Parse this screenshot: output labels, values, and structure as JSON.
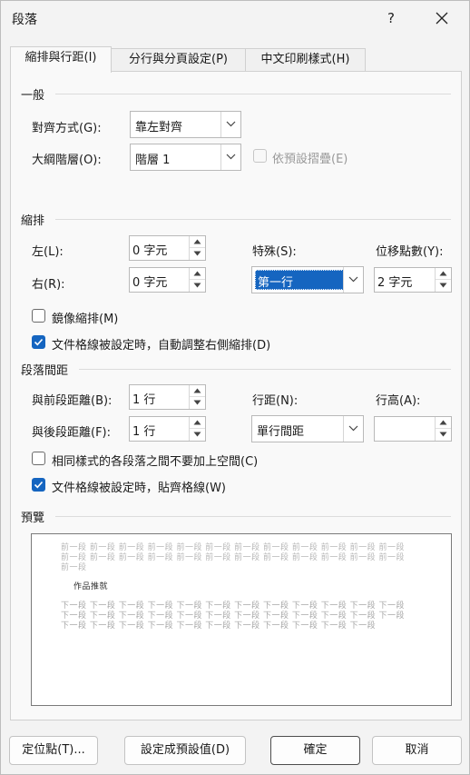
{
  "window": {
    "title": "段落",
    "help_icon": "?",
    "close_icon": "×"
  },
  "tabs": [
    {
      "label": "縮排與行距(I)",
      "active": true
    },
    {
      "label": "分行與分頁設定(P)",
      "active": false
    },
    {
      "label": "中文印刷樣式(H)",
      "active": false
    }
  ],
  "general": {
    "heading": "一般",
    "alignment_label": "對齊方式(G):",
    "alignment_value": "靠左對齊",
    "outline_label": "大綱階層(O):",
    "outline_value": "階層 1",
    "collapse_label": "依預設摺疊(E)"
  },
  "indent": {
    "heading": "縮排",
    "left_label": "左(L):",
    "left_value": "0 字元",
    "right_label": "右(R):",
    "right_value": "0 字元",
    "special_label": "特殊(S):",
    "special_value": "第一行",
    "by_label": "位移點數(Y):",
    "by_value": "2 字元",
    "mirror_label": "鏡像縮排(M)",
    "auto_adjust_label": "文件格線被設定時，自動調整右側縮排(D)"
  },
  "spacing": {
    "heading": "段落間距",
    "before_label": "與前段距離(B):",
    "before_value": "1 行",
    "after_label": "與後段距離(F):",
    "after_value": "1 行",
    "line_spacing_label": "行距(N):",
    "line_spacing_value": "單行間距",
    "at_label": "行高(A):",
    "at_value": "",
    "no_space_label": "相同樣式的各段落之間不要加上空間(C)",
    "snap_grid_label": "文件格線被設定時，貼齊格線(W)"
  },
  "preview": {
    "heading": "預覽",
    "prev_line_1": "前一段 前一段 前一段 前一段 前一段 前一段 前一段 前一段 前一段 前一段 前一段 前一段",
    "prev_line_2": "前一段 前一段 前一段 前一段 前一段 前一段 前一段 前一段 前一段 前一段 前一段 前一段",
    "prev_line_3": "前一段",
    "sample": "作品推就",
    "next_line_1": "下一段 下一段 下一段 下一段 下一段 下一段 下一段 下一段 下一段 下一段 下一段 下一段",
    "next_line_2": "下一段 下一段 下一段 下一段 下一段 下一段 下一段 下一段 下一段 下一段 下一段 下一段",
    "next_line_3": "下一段 下一段 下一段 下一段 下一段 下一段 下一段 下一段 下一段 下一段 下一段"
  },
  "buttons": {
    "tabs_label": "定位點(T)...",
    "default_label": "設定成預設值(D)",
    "ok_label": "確定",
    "cancel_label": "取消"
  },
  "colors": {
    "accent": "#1565c0",
    "selection": "#1565c0"
  }
}
